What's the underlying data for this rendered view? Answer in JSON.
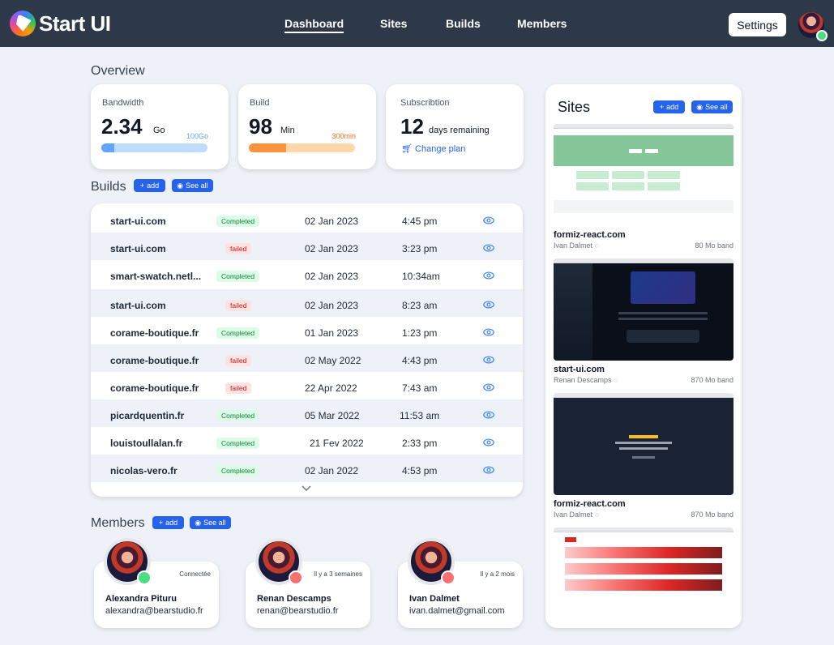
{
  "app": {
    "brand": "Start UI"
  },
  "nav": {
    "items": [
      "Dashboard",
      "Sites",
      "Builds",
      "Members"
    ],
    "active": "Dashboard",
    "settings_label": "Settings"
  },
  "overview": {
    "title": "Overview",
    "bandwidth": {
      "label": "Bandwidth",
      "value": "2.34",
      "unit": "Go",
      "cap": "100Go",
      "progress": 0.12,
      "color": "#93c5fd"
    },
    "build": {
      "label": "Build",
      "value": "98",
      "unit": "Min",
      "cap": "300min",
      "progress": 0.35,
      "color": "#fb923c"
    },
    "subscription": {
      "label": "Subscribtion",
      "value": "12",
      "unit": "days remaining",
      "link": "Change plan"
    }
  },
  "builds": {
    "title": "Builds",
    "add_label": "add",
    "see_all_label": "See all",
    "rows": [
      {
        "site": "start-ui.com",
        "status": "Completed",
        "date": "02 Jan 2023",
        "time": "4:45 pm"
      },
      {
        "site": "start-ui.com",
        "status": "failed",
        "date": "02 Jan 2023",
        "time": "3:23 pm"
      },
      {
        "site": "smart-swatch.netl...",
        "status": "Completed",
        "date": "02 Jan 2023",
        "time": "10:34am"
      },
      {
        "site": "start-ui.com",
        "status": "failed",
        "date": "02 Jan 2023",
        "time": "8:23 am"
      },
      {
        "site": "corame-boutique.fr",
        "status": "Completed",
        "date": "01 Jan 2023",
        "time": "1:23 pm"
      },
      {
        "site": "corame-boutique.fr",
        "status": "failed",
        "date": "02 May 2022",
        "time": "4:43 pm"
      },
      {
        "site": "corame-boutique.fr",
        "status": "failed",
        "date": "22 Apr 2022",
        "time": "7:43 am"
      },
      {
        "site": "picardquentin.fr",
        "status": "Completed",
        "date": "05 Mar 2022",
        "time": "11:53 am"
      },
      {
        "site": "louistoullalan.fr",
        "status": "Completed",
        "date": "21 Fev 2022",
        "time": "2:33 pm"
      },
      {
        "site": "nicolas-vero.fr",
        "status": "Completed",
        "date": "02 Jan 2022",
        "time": "4:53 pm"
      }
    ]
  },
  "members": {
    "title": "Members",
    "add_label": "add",
    "see_all_label": "See all",
    "items": [
      {
        "name": "Alexandra Pituru",
        "email": "alexandra@bearstudio.fr",
        "status": "Connectée",
        "online": true
      },
      {
        "name": "Renan Descamps",
        "email": "renan@bearstudio.fr",
        "status": "Il y a 3 semaines",
        "online": false
      },
      {
        "name": "Ivan Dalmet",
        "email": "ivan.dalmet@gmail.com",
        "status": "Il y a 2 mois",
        "online": false
      }
    ]
  },
  "sites": {
    "title": "Sites",
    "add_label": "add",
    "see_all_label": "See all",
    "items": [
      {
        "name": "formiz-react.com",
        "author": "Ivan Dalmet",
        "band": "80 Mo band",
        "theme": "green"
      },
      {
        "name": "start-ui.com",
        "author": "Renan Descamps",
        "band": "870 Mo band",
        "theme": "dark"
      },
      {
        "name": "formiz-react.com",
        "author": "Ivan Dalmet",
        "band": "870 Mo band",
        "theme": "navy"
      },
      {
        "name": "",
        "author": "",
        "band": "",
        "theme": "red"
      }
    ]
  },
  "colors": {
    "nav_bg": "#2d3849",
    "primary": "#2563eb",
    "online": "#4ade80",
    "offline": "#f87171"
  }
}
